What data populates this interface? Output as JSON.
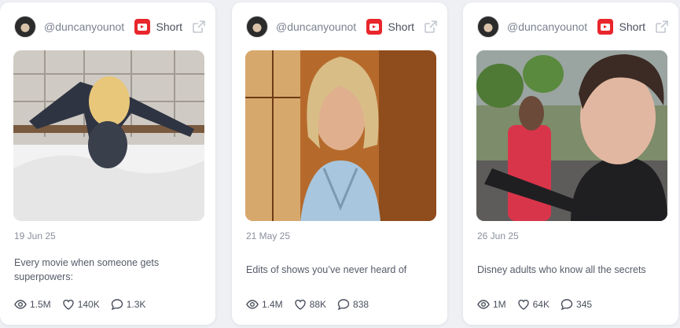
{
  "cards": [
    {
      "handle": "@duncanyounot",
      "type_label": "Short",
      "date": "19 Jun 25",
      "caption": "Every movie when someone gets superpowers:",
      "views": "1.5M",
      "likes": "140K",
      "comments": "1.3K"
    },
    {
      "handle": "@duncanyounot",
      "type_label": "Short",
      "date": "21 May 25",
      "caption": "Edits of shows you’ve never heard of",
      "views": "1.4M",
      "likes": "88K",
      "comments": "838"
    },
    {
      "handle": "@duncanyounot",
      "type_label": "Short",
      "date": "26 Jun 25",
      "caption": "Disney adults who know all the secrets",
      "views": "1M",
      "likes": "64K",
      "comments": "345"
    }
  ],
  "colors": {
    "youtube_red": "#e8262b",
    "page_background": "#eef0f4",
    "card_background": "#ffffff",
    "muted_text": "#8a8f9c"
  },
  "icons": [
    "youtube-icon",
    "external-link-icon",
    "eye-icon",
    "heart-icon",
    "comment-icon"
  ]
}
